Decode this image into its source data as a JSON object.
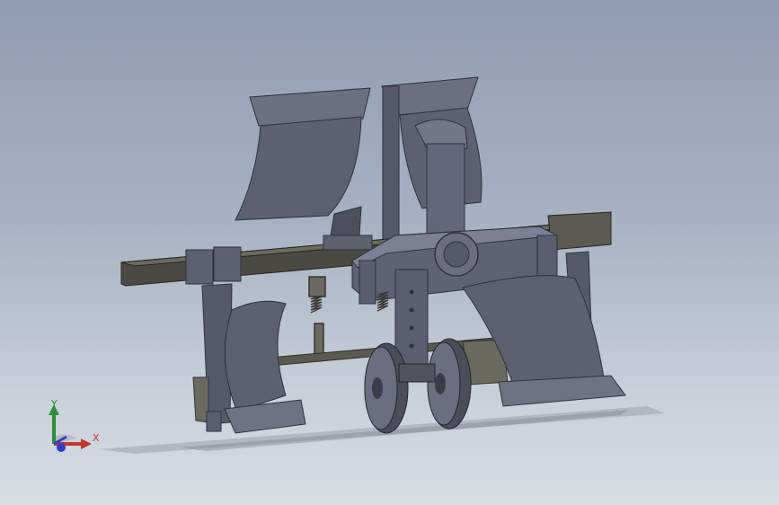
{
  "app": "CAD 3D viewport",
  "scene": {
    "model": "plough-assembly",
    "parts": [
      "mouldboard-left",
      "mouldboard-right",
      "mouldboard-rear-upper",
      "mouldboard-rear-lower",
      "main-frame-beam",
      "center-hitch-plate",
      "depth-wheels",
      "coil-springs",
      "plough-shares"
    ],
    "colors": {
      "background_top": "#8f9db0",
      "background_bottom": "#d6dce4",
      "metal": "#5c6170",
      "metal_dark": "#3c404c",
      "metal_light": "#8a8fa0",
      "beam": "#4a4a42"
    }
  },
  "triad": {
    "x_label": "X",
    "y_label": "Y",
    "x_color": "#c0392b",
    "y_color": "#2e8b3a",
    "z_color": "#2f3fbf"
  }
}
